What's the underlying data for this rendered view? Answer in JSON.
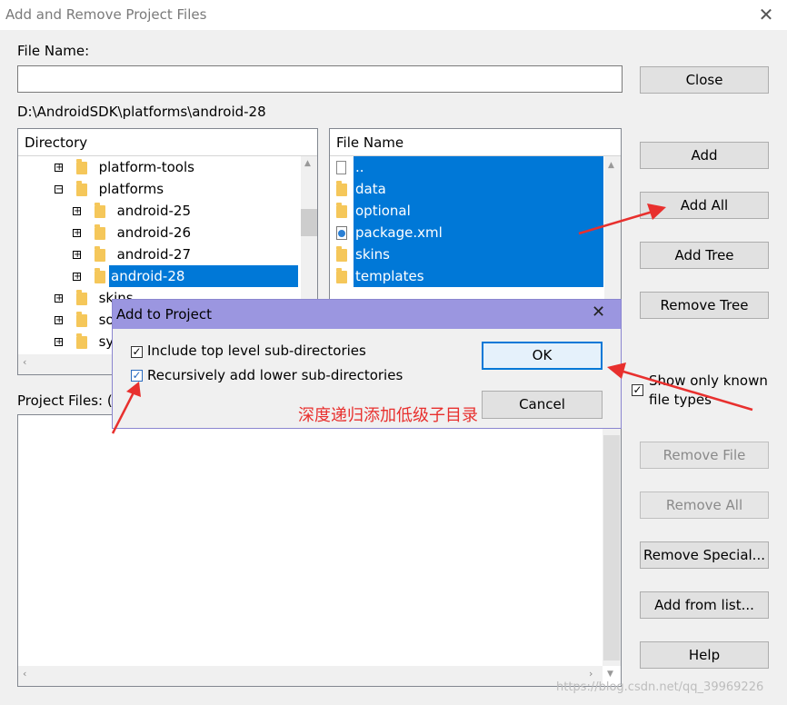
{
  "window": {
    "title": "Add and Remove Project Files",
    "close_glyph": "✕"
  },
  "file_name": {
    "label": "File Name:",
    "value": ""
  },
  "current_path": "D:\\AndroidSDK\\platforms\\android-28",
  "directory": {
    "header": "Directory",
    "items": [
      {
        "label": "platform-tools",
        "expander": "+"
      },
      {
        "label": "platforms",
        "expander": "−"
      },
      {
        "label": "android-25",
        "expander": "+"
      },
      {
        "label": "android-26",
        "expander": "+"
      },
      {
        "label": "android-27",
        "expander": "+"
      },
      {
        "label": "android-28",
        "expander": "+",
        "selected": true
      },
      {
        "label": "skins",
        "expander": "+"
      },
      {
        "label": "sou",
        "expander": "+"
      },
      {
        "label": "sys",
        "expander": "+"
      }
    ]
  },
  "files": {
    "header": "File Name",
    "items": [
      {
        "label": "..",
        "icon": "file-icon"
      },
      {
        "label": "data",
        "icon": "folder-icon"
      },
      {
        "label": "optional",
        "icon": "folder-icon"
      },
      {
        "label": "package.xml",
        "icon": "xml-file-icon"
      },
      {
        "label": "skins",
        "icon": "folder-icon"
      },
      {
        "label": "templates",
        "icon": "folder-icon"
      }
    ]
  },
  "project_files": {
    "label": "Project Files: (("
  },
  "show_known": {
    "label_line1": "Show only known",
    "label_line2": "file types",
    "checked": true
  },
  "buttons": {
    "close": "Close",
    "add": "Add",
    "add_all": "Add All",
    "add_tree": "Add Tree",
    "remove_tree": "Remove Tree",
    "remove_file": "Remove File",
    "remove_all": "Remove All",
    "remove_special": "Remove Special...",
    "add_from_list": "Add from list...",
    "help": "Help"
  },
  "dialog": {
    "title": "Add to Project",
    "close_glyph": "✕",
    "opt1": "Include top level sub-directories",
    "opt2": "Recursively add lower sub-directories",
    "ok": "OK",
    "cancel": "Cancel",
    "annotation": "深度递归添加低级子目录"
  },
  "watermark": "https://blog.csdn.net/qq_39969226",
  "colors": {
    "selection": "#0078d7",
    "annotation": "#e8302e",
    "dialog_title": "#9b96e0"
  }
}
